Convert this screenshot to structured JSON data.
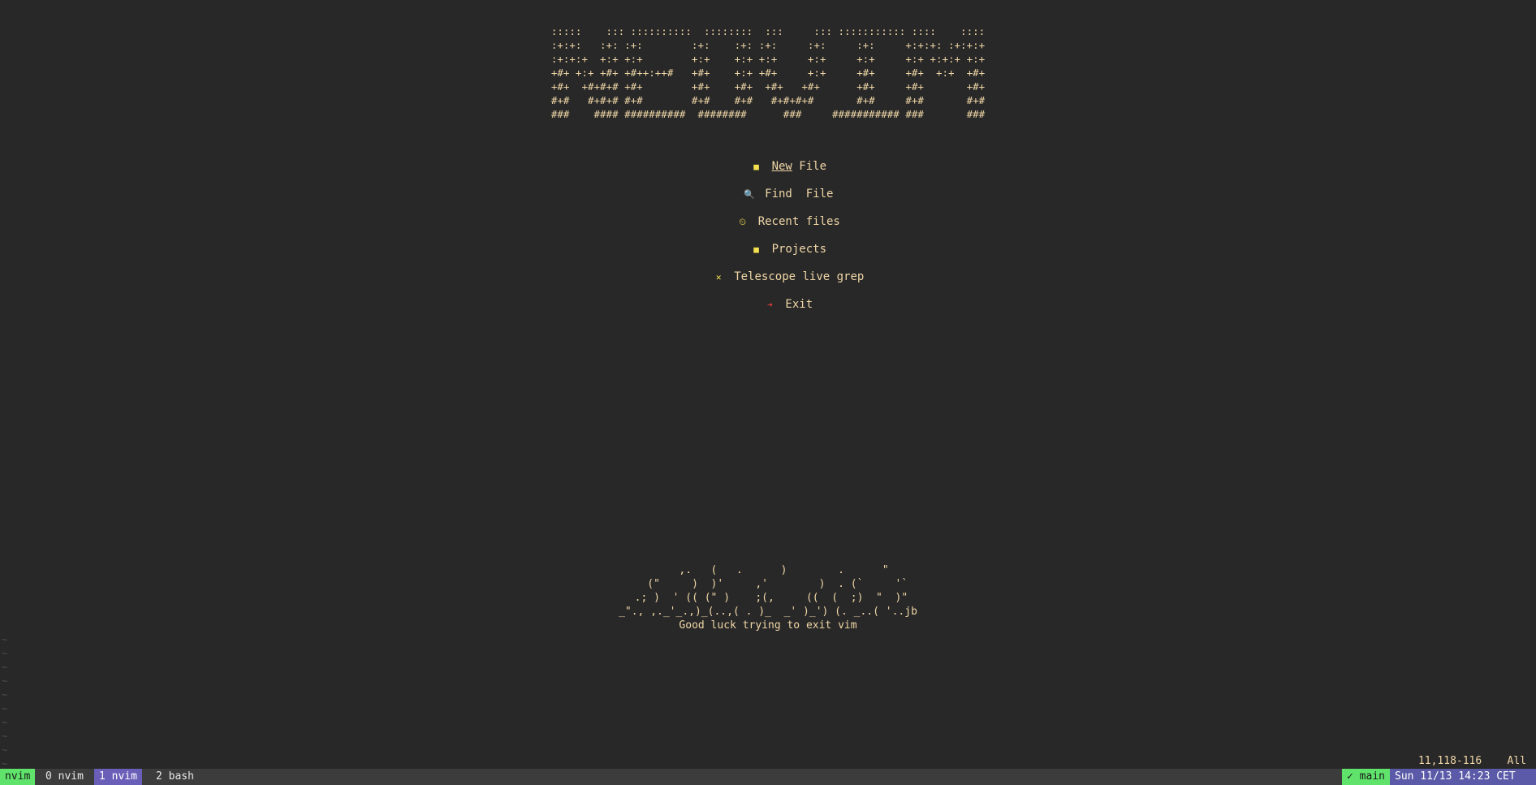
{
  "banner": {
    "ascii_logo": ":::::    ::: ::::::::::  ::::::::  :::     ::: ::::::::::: ::::    ::::\n:+:+:   :+: :+:        :+:    :+: :+:     :+:     :+:     +:+:+: :+:+:+\n:+:+:+  +:+ +:+        +:+    +:+ +:+     +:+     +:+     +:+ +:+:+ +:+\n+#+ +:+ +#+ +#++:++#   +#+    +:+ +#+     +:+     +#+     +#+  +:+  +#+\n+#+  +#+#+# +#+        +#+    +#+  +#+   +#+      +#+     +#+       +#+\n#+#   #+#+# #+#        #+#    #+#   #+#+#+#       #+#     #+#       #+#\n###    #### ##########  ########      ###     ########### ###       ###"
  },
  "menu": {
    "items": [
      {
        "icon": "file-icon",
        "glyph": "■",
        "shortcut": "New",
        "label": " File"
      },
      {
        "icon": "search-icon",
        "glyph": "🔍",
        "label": "Find  File"
      },
      {
        "icon": "history-icon",
        "glyph": "⏲",
        "label": "Recent files"
      },
      {
        "icon": "folder-icon",
        "glyph": "■",
        "label": "Projects"
      },
      {
        "icon": "tools-icon",
        "glyph": "✕",
        "label": "Telescope live grep"
      },
      {
        "icon": "exit-icon",
        "glyph": "➜",
        "label": "Exit"
      }
    ]
  },
  "footer": {
    "art": "     ,.   (   .      )        .      \"\n   (\"     )  )'     ,'        )  . (`     '`\n .; )  ' (( (\" )    ;(,     ((  (  ;)  \"  )\"\n_\"., ,._'_.,)_(..,( . )_  _' )_') (. _..( '..jb",
    "tagline": "Good luck trying to exit vim"
  },
  "editor": {
    "tilde_rows": [
      "~",
      "~",
      "~",
      "~",
      "~",
      "~",
      "~",
      "~",
      "~",
      "~"
    ],
    "ruler": "11,118-116    All"
  },
  "statusbar": {
    "mode": "nvim",
    "windows": [
      "0 nvim",
      "1 nvim",
      "2 bash"
    ],
    "branch": "✓ main",
    "clock": "Sun 11/13 14:23 CET"
  },
  "colors": {
    "background": "#282828",
    "text": "#f0d7a7",
    "icon": "#f5e14f",
    "exit_icon": "#e23b3b",
    "mode_green": "#5fe36b",
    "window_active": "#6a5fb8",
    "clock_bg": "#5a5aa8"
  }
}
